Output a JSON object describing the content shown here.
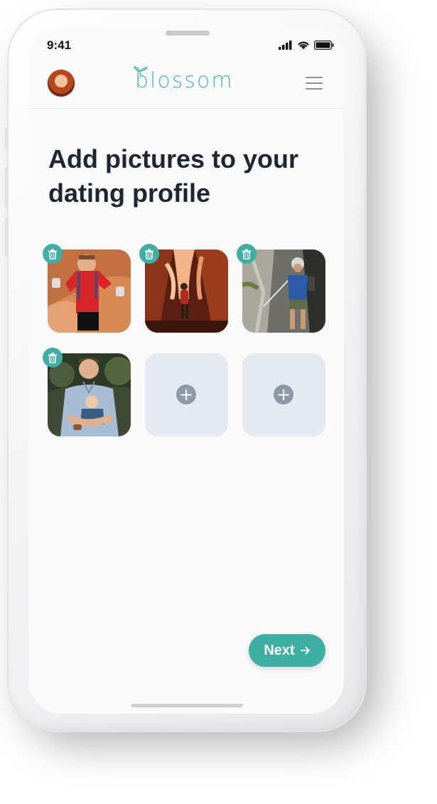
{
  "status_bar": {
    "time": "9:41"
  },
  "header": {
    "app_name": "blossom",
    "avatar_icon": "user-avatar",
    "menu_icon": "hamburger-menu-icon"
  },
  "page": {
    "title": "Add pictures to your dating profile"
  },
  "photos": [
    {
      "slot": 1,
      "filled": true,
      "description": "man-red-shirt-canyon"
    },
    {
      "slot": 2,
      "filled": true,
      "description": "canyon-hiker"
    },
    {
      "slot": 3,
      "filled": true,
      "description": "rock-climber"
    },
    {
      "slot": 4,
      "filled": true,
      "description": "man-holding-baby"
    },
    {
      "slot": 5,
      "filled": false
    },
    {
      "slot": 6,
      "filled": false
    }
  ],
  "actions": {
    "next_label": "Next",
    "next_icon": "arrow-right-icon"
  },
  "colors": {
    "accent": "#3fafa3",
    "title": "#1f2633",
    "empty_tile": "#e5eaf0"
  }
}
